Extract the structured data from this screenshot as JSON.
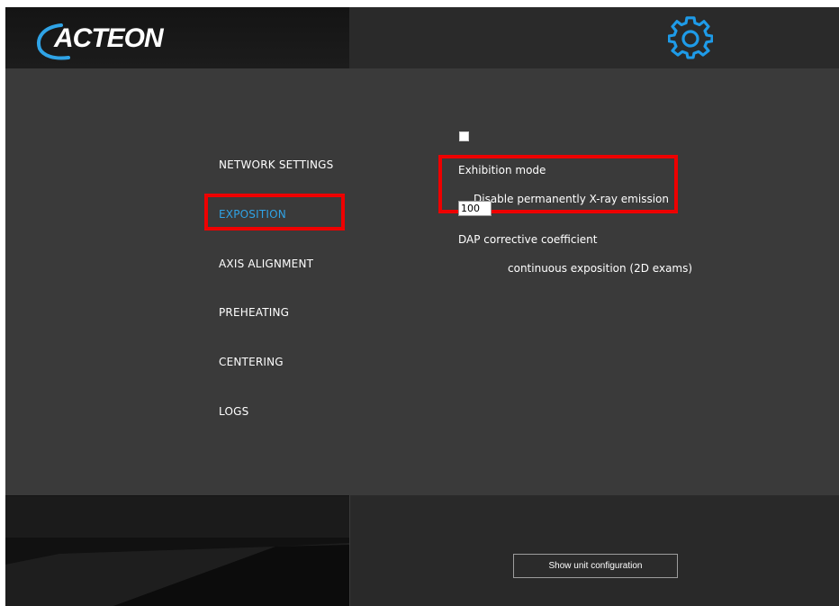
{
  "header": {
    "logo_text": "ACTEON",
    "settings_icon": "gear-icon"
  },
  "sidebar": {
    "items": [
      {
        "label": "NETWORK SETTINGS",
        "active": false
      },
      {
        "label": "EXPOSITION",
        "active": true
      },
      {
        "label": "AXIS ALIGNMENT",
        "active": false
      },
      {
        "label": "PREHEATING",
        "active": false
      },
      {
        "label": "CENTERING",
        "active": false
      },
      {
        "label": "LOGS",
        "active": false
      }
    ]
  },
  "exposition": {
    "exhibition_mode_title": "Exhibition mode",
    "disable_xray_label": "Disable permanently X-ray emission",
    "disable_xray_checked": false,
    "dap_title": "DAP corrective coefficient",
    "dap_value": "100",
    "dap_description": "continuous exposition (2D exams)"
  },
  "footer": {
    "show_unit_config_label": "Show unit configuration"
  },
  "colors": {
    "accent": "#2fa3e6",
    "highlight": "#ee0000",
    "background": "#3a3a3a"
  }
}
